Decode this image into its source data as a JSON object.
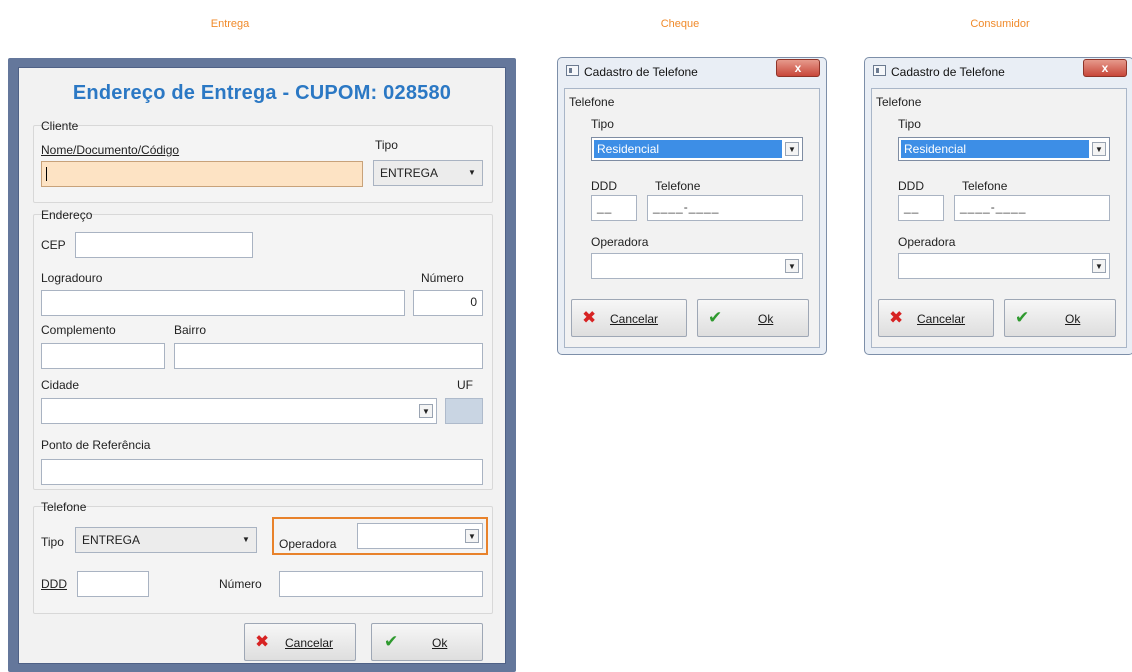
{
  "captions": {
    "entrega": "Entrega",
    "cheque": "Cheque",
    "consumidor": "Consumidor"
  },
  "main": {
    "title": "Endereço de Entrega - CUPOM: 028580",
    "cliente": {
      "group_label": "Cliente",
      "nome_label": "Nome/Documento/Código",
      "nome_value": "",
      "tipo_label": "Tipo",
      "tipo_value": "ENTREGA"
    },
    "endereco": {
      "group_label": "Endereço",
      "cep_label": "CEP",
      "logradouro_label": "Logradouro",
      "numero_label": "Número",
      "numero_value": "0",
      "complemento_label": "Complemento",
      "bairro_label": "Bairro",
      "cidade_label": "Cidade",
      "uf_label": "UF",
      "referencia_label": "Ponto de Referência"
    },
    "telefone": {
      "group_label": "Telefone",
      "tipo_label": "Tipo",
      "tipo_value": "ENTREGA",
      "operadora_label": "Operadora",
      "ddd_label": "DDD",
      "numero_label": "Número"
    },
    "buttons": {
      "cancel": "Cancelar",
      "ok": "Ok"
    }
  },
  "dialogs": [
    {
      "title": "Cadastro de Telefone",
      "close_glyph": "x",
      "group_label": "Telefone",
      "tipo_label": "Tipo",
      "tipo_value": "Residencial",
      "ddd_label": "DDD",
      "ddd_mask": "__",
      "telefone_label": "Telefone",
      "telefone_mask": "____-____",
      "operadora_label": "Operadora",
      "cancel": "Cancelar",
      "ok": "Ok"
    },
    {
      "title": "Cadastro de Telefone",
      "close_glyph": "x",
      "group_label": "Telefone",
      "tipo_label": "Tipo",
      "tipo_value": "Residencial",
      "ddd_label": "DDD",
      "ddd_mask": "__",
      "telefone_label": "Telefone",
      "telefone_mask": "____-____",
      "operadora_label": "Operadora",
      "cancel": "Cancelar",
      "ok": "Ok"
    }
  ],
  "icons": {
    "dropdown": "▼",
    "cancel": "✖",
    "ok": "✔"
  },
  "colors": {
    "caption": "#f08a2a",
    "title": "#2b78c4",
    "highlight": "#e8822b",
    "selection": "#3d8ee6"
  }
}
